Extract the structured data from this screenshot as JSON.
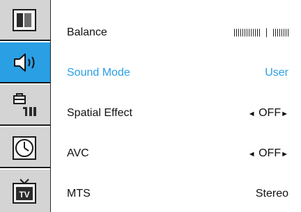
{
  "sidebar": {
    "tabs": [
      {
        "icon": "picture-icon",
        "active": false
      },
      {
        "icon": "speaker-icon",
        "active": true
      },
      {
        "icon": "setup-tools-icon",
        "active": false
      },
      {
        "icon": "clock-icon",
        "active": false
      },
      {
        "icon": "tv-icon",
        "active": false
      }
    ]
  },
  "menu": {
    "rows": [
      {
        "label": "Balance",
        "value": "IIIIIIIIIIIII | IIIIIIII",
        "balance_left_ticks": 13,
        "balance_right_ticks": 8
      },
      {
        "label": "Sound Mode",
        "value": "User",
        "selected": true
      },
      {
        "label": "Spatial Effect",
        "value": "OFF",
        "arrow_left": "◄",
        "arrow_right": "►"
      },
      {
        "label": "AVC",
        "value": "OFF",
        "arrow_left": "◄",
        "arrow_right": "►"
      },
      {
        "label": "MTS",
        "value": "Stereo"
      }
    ]
  },
  "colors": {
    "accent": "#2a9fe4",
    "tab_inactive": "#d4d4d4",
    "text": "#111111"
  }
}
